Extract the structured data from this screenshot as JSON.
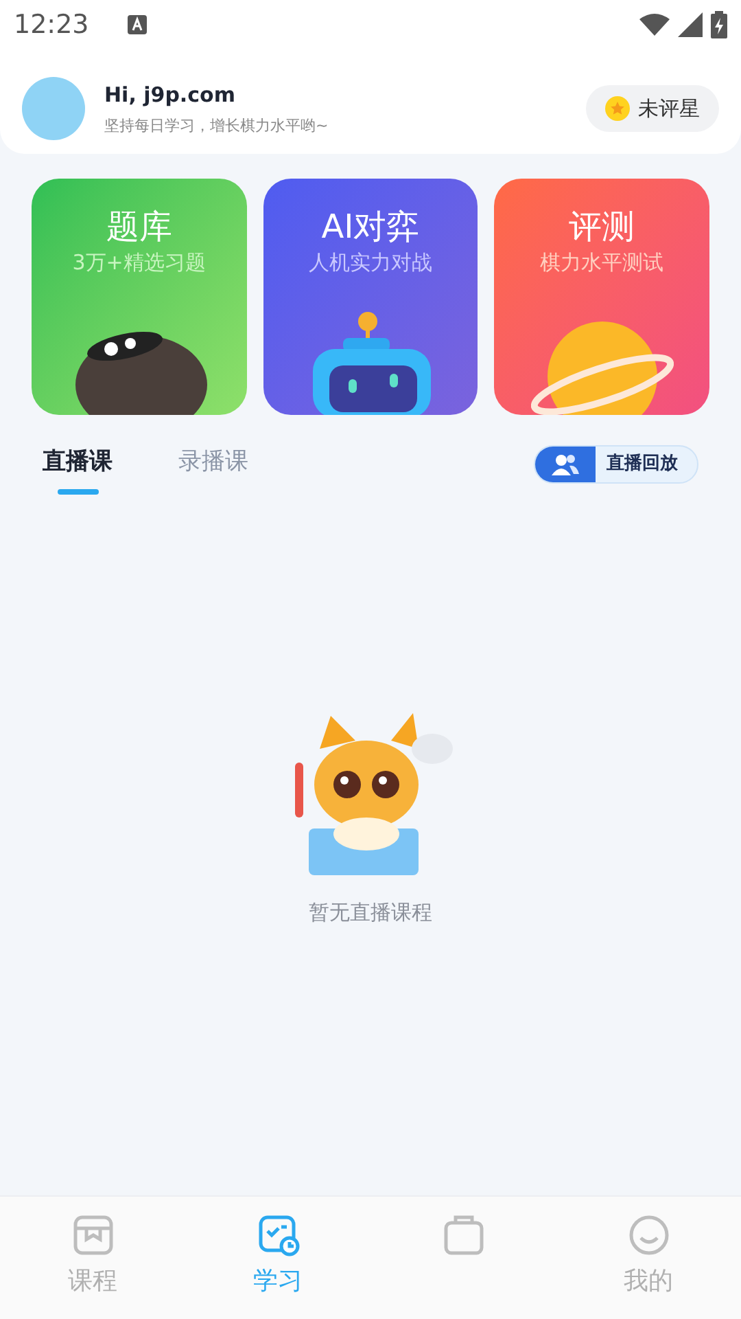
{
  "status_bar": {
    "time": "12:23"
  },
  "header": {
    "greeting": "Hi, j9p.com",
    "subtitle": "坚持每日学习，增长棋力水平哟~",
    "rating_badge": "未评星"
  },
  "feature_cards": [
    {
      "kind": "stone",
      "title": "题库",
      "subtitle": "3万+精选习题"
    },
    {
      "kind": "robot",
      "title": "AI对弈",
      "subtitle": "人机实力对战"
    },
    {
      "kind": "planet",
      "title": "评测",
      "subtitle": "棋力水平测试"
    }
  ],
  "course_tabs": [
    {
      "label": "直播课",
      "selected": true
    },
    {
      "label": "录播课",
      "selected": false
    }
  ],
  "replay_button": "直播回放",
  "empty_state": {
    "message": "暂无直播课程"
  },
  "bottom_nav": [
    {
      "kind": "book",
      "label": "课程",
      "selected": false
    },
    {
      "kind": "study",
      "label": "学习",
      "selected": true
    },
    {
      "kind": "bag",
      "selected": false
    },
    {
      "kind": "face",
      "label": "我的",
      "selected": false
    }
  ]
}
